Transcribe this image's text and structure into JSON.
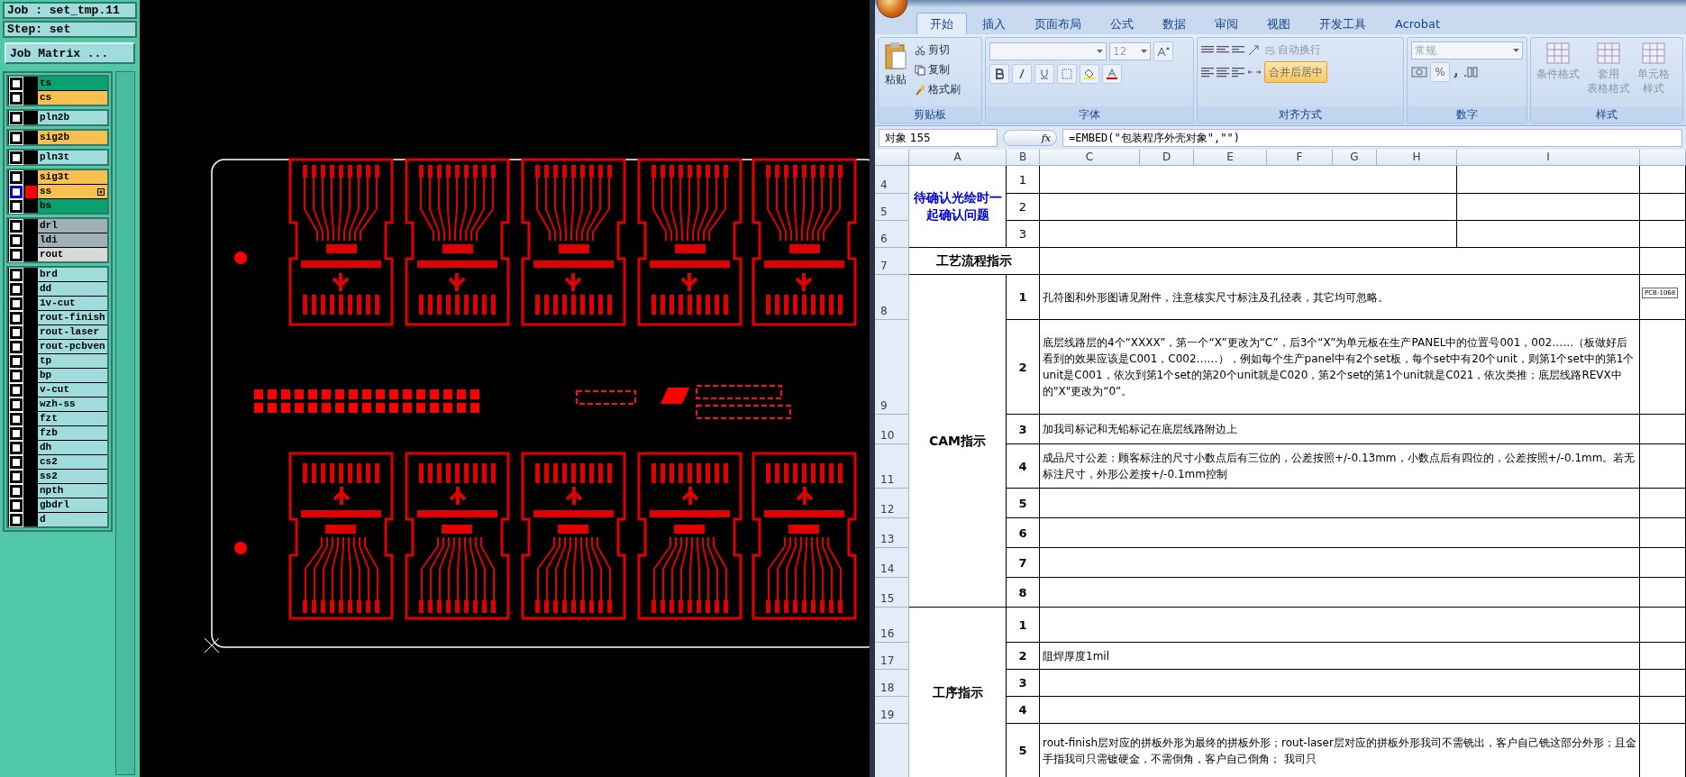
{
  "layer_panel": {
    "job": "Job : set_tmp.11",
    "step": "Step: set",
    "matrix_button": "Job Matrix ...",
    "groups": [
      [
        {
          "name": "ts",
          "color": "#0aa070",
          "checked": false,
          "selected": false
        },
        {
          "name": "cs",
          "color": "#f8c050",
          "checked": false,
          "selected": false
        }
      ],
      [
        {
          "name": "pln2b",
          "color": "#a0dcdc",
          "checked": false,
          "selected": false
        }
      ],
      [
        {
          "name": "sig2b",
          "color": "#f8c050",
          "checked": false,
          "selected": false
        }
      ],
      [
        {
          "name": "pln3t",
          "color": "#a0dcdc",
          "checked": false,
          "selected": false
        }
      ],
      [
        {
          "name": "sig3t",
          "color": "#f8c050",
          "checked": false,
          "selected": false
        },
        {
          "name": "ss",
          "color": "#f8c050",
          "checked": false,
          "selected": true
        },
        {
          "name": "bs",
          "color": "#0aa070",
          "checked": false,
          "selected": false
        }
      ],
      [
        {
          "name": "drl",
          "color": "#a0b0b8",
          "checked": false,
          "selected": false
        },
        {
          "name": "ldi",
          "color": "#a0b0b8",
          "checked": false,
          "selected": false
        },
        {
          "name": "rout",
          "color": "#d8d8d8",
          "checked": false,
          "selected": false
        }
      ],
      [
        {
          "name": "brd",
          "color": "#a0dcdc",
          "checked": false,
          "selected": false
        },
        {
          "name": "dd",
          "color": "#a0dcdc",
          "checked": false,
          "selected": false
        },
        {
          "name": "1v-cut",
          "color": "#a0dcdc",
          "checked": false,
          "selected": false
        },
        {
          "name": "rout-finish",
          "color": "#a0dcdc",
          "checked": false,
          "selected": false
        },
        {
          "name": "rout-laser",
          "color": "#a0dcdc",
          "checked": false,
          "selected": false
        },
        {
          "name": "rout-pcbven",
          "color": "#a0dcdc",
          "checked": false,
          "selected": false
        },
        {
          "name": "tp",
          "color": "#a0dcdc",
          "checked": false,
          "selected": false
        },
        {
          "name": "bp",
          "color": "#a0dcdc",
          "checked": false,
          "selected": false
        },
        {
          "name": "v-cut",
          "color": "#a0dcdc",
          "checked": false,
          "selected": false
        },
        {
          "name": "wzh-ss",
          "color": "#a0dcdc",
          "checked": false,
          "selected": false
        },
        {
          "name": "fzt",
          "color": "#a0dcdc",
          "checked": false,
          "selected": false
        },
        {
          "name": "fzb",
          "color": "#a0dcdc",
          "checked": false,
          "selected": false
        },
        {
          "name": "dh",
          "color": "#a0dcdc",
          "checked": false,
          "selected": false
        },
        {
          "name": "cs2",
          "color": "#a0dcdc",
          "checked": false,
          "selected": false
        },
        {
          "name": "ss2",
          "color": "#a0dcdc",
          "checked": false,
          "selected": false
        },
        {
          "name": "npth",
          "color": "#a0dcdc",
          "checked": false,
          "selected": false
        },
        {
          "name": "gbdrl",
          "color": "#a0dcdc",
          "checked": false,
          "selected": false
        },
        {
          "name": "d",
          "color": "#a0dcdc",
          "checked": false,
          "selected": false
        }
      ]
    ]
  },
  "excel": {
    "tabs": [
      {
        "label": "开始",
        "selected": true
      },
      {
        "label": "插入",
        "selected": false
      },
      {
        "label": "页面布局",
        "selected": false
      },
      {
        "label": "公式",
        "selected": false
      },
      {
        "label": "数据",
        "selected": false
      },
      {
        "label": "审阅",
        "selected": false
      },
      {
        "label": "视图",
        "selected": false
      },
      {
        "label": "开发工具",
        "selected": false
      },
      {
        "label": "Acrobat",
        "selected": false
      }
    ],
    "ribbon": {
      "clipboard": {
        "label": "剪贴板",
        "paste": "粘贴",
        "cut": "剪切",
        "copy": "复制",
        "format_painter": "格式刷"
      },
      "font": {
        "label": "字体",
        "size": "12"
      },
      "alignment": {
        "label": "对齐方式",
        "wrap": "自动换行",
        "merge": {
          "label": "合并后居中",
          "on": true
        }
      },
      "number": {
        "label": "数字",
        "format": "常规",
        "percent": "%"
      },
      "styles": {
        "label": "样式",
        "buttons": [
          {
            "lines": [
              "条件格式"
            ]
          },
          {
            "lines": [
              "套用",
              "表格格式"
            ]
          },
          {
            "lines": [
              "单元格",
              "样式"
            ]
          }
        ]
      }
    },
    "name_box": "对象 155",
    "function_button": "fx",
    "formula": "=EMBED(\"包装程序外壳对象\",\"\")",
    "columns": [
      "A",
      "B",
      "C",
      "D",
      "E",
      "F",
      "G",
      "H",
      "I"
    ],
    "sections": [
      {
        "kind": "questions",
        "title": "待确认光绘时一起确认问题",
        "color": "#0000cc",
        "items": [
          {
            "row": "4",
            "no": "1"
          },
          {
            "row": "5",
            "no": "2"
          },
          {
            "row": "6",
            "no": "3"
          }
        ]
      },
      {
        "kind": "heading",
        "title": "工艺流程指示",
        "color": "#000000",
        "row": "7"
      },
      {
        "kind": "instructions",
        "title": "CAM指示",
        "color": "#000000",
        "items": [
          {
            "row": "8",
            "no": "1",
            "text": "孔符图和外形图请见附件，注意核实尺寸标注及孔径表，其它均可忽略。",
            "attachment": "PCB-1068"
          },
          {
            "row": "9",
            "no": "2",
            "text": "底层线路层的4个“XXXX”，第一个“X”更改为“C”，后3个“X”为单元板在生产PANEL中的位置号001，002……（板做好后看到的效果应该是C001，C002……），例如每个生产panel中有2个set板，每个set中有20个unit，则第1个set中的第1个unit是C001，依次到第1个set的第20个unit就是C020，第2个set的第1个unit就是C021，依次类推；底层线路REVX中的\"X\"更改为“0”。"
          },
          {
            "row": "10",
            "no": "3",
            "text": "加我司标记和无铅标记在底层线路附边上"
          },
          {
            "row": "11",
            "no": "4",
            "text": "成品尺寸公差：顾客标注的尺寸小数点后有三位的，公差按照+/-0.13mm，小数点后有四位的，公差按照+/-0.1mm。若无标注尺寸，外形公差按+/-0.1mm控制"
          },
          {
            "row": "12",
            "no": "5"
          },
          {
            "row": "13",
            "no": "6"
          },
          {
            "row": "14",
            "no": "7"
          },
          {
            "row": "15",
            "no": "8"
          }
        ]
      },
      {
        "kind": "instructions",
        "title": "工序指示",
        "color": "#000000",
        "items": [
          {
            "row": "16",
            "no": "1"
          },
          {
            "row": "17",
            "no": "2",
            "text": "阻焊厚度1mil"
          },
          {
            "row": "18",
            "no": "3"
          },
          {
            "row": "19",
            "no": "4"
          },
          {
            "no": "5",
            "text": "rout-finish层对应的拼板外形为最终的拼板外形；rout-laser层对应的拼板外形我司不需铣出，客户自己铣这部分外形；且金手指我司只需镀硬金，不需倒角，客户自己倒角； 我司只"
          }
        ]
      }
    ]
  }
}
